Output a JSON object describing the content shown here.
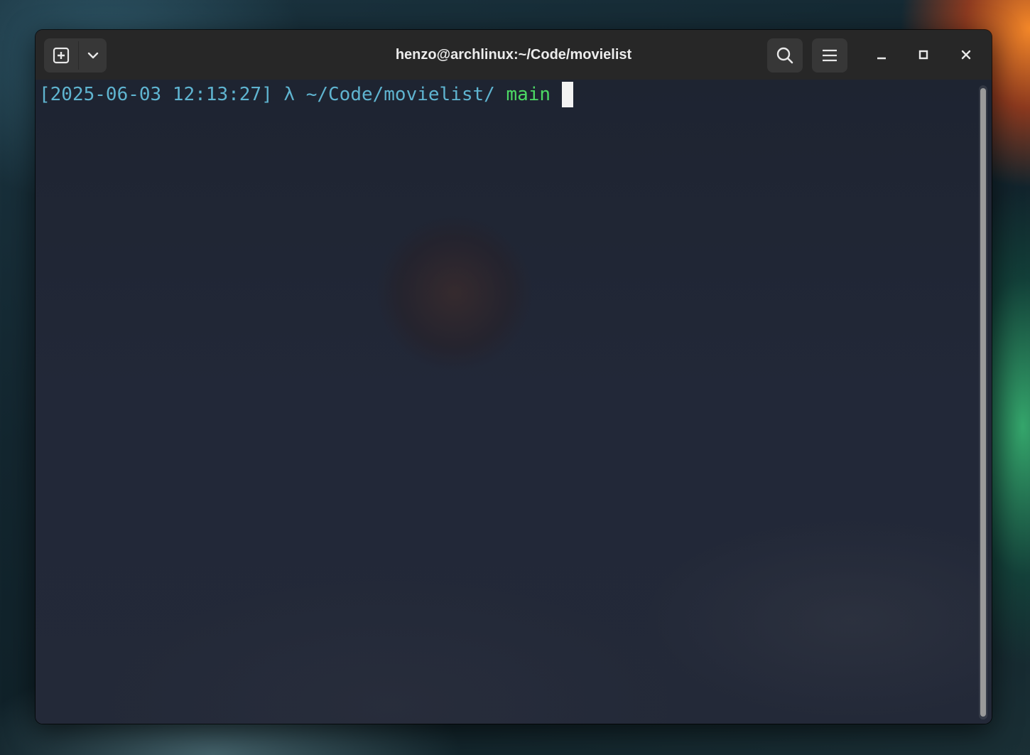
{
  "window": {
    "title": "henzo@archlinux:~/Code/movielist"
  },
  "titlebar": {
    "new_tab_icon": "plus-square-icon",
    "tab_menu_icon": "chevron-down-icon",
    "search_icon": "search-icon",
    "menu_icon": "hamburger-menu-icon",
    "minimize_icon": "minimize-icon",
    "maximize_icon": "maximize-icon",
    "close_icon": "close-icon"
  },
  "terminal": {
    "prompt": {
      "timestamp": "[2025-06-03 12:13:27]",
      "symbol": "λ",
      "path": "~/Code/movielist/",
      "branch": "main"
    },
    "colors": {
      "prompt_cyan": "#5fb4d0",
      "branch_green": "#4cd964",
      "background": "#202633"
    }
  }
}
